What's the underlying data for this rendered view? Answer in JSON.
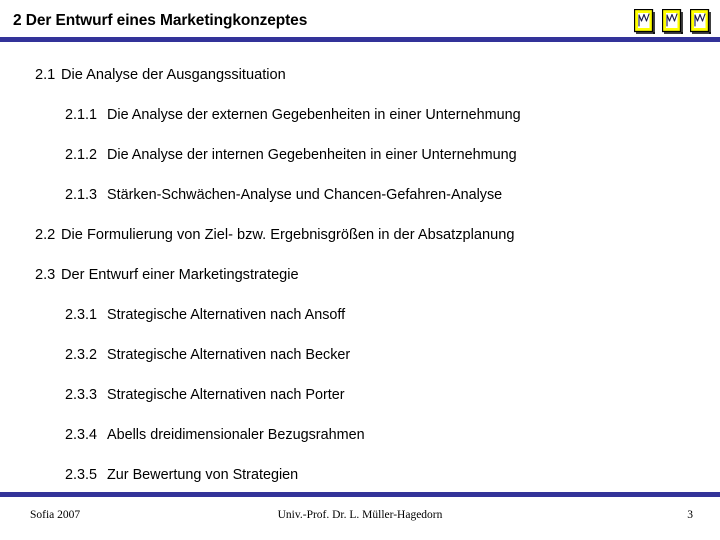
{
  "slide": {
    "header": {
      "title": "2 Der Entwurf eines Marketingkonzeptes",
      "icons": [
        {
          "name": "note-page-icon-1",
          "label": "note-page-icon"
        },
        {
          "name": "note-page-icon-2",
          "label": "note-page-icon"
        },
        {
          "name": "note-page-icon-3",
          "label": "note-page-icon"
        }
      ]
    },
    "colors": {
      "accent_rule": "#333399",
      "icon_fill": "#ffff00",
      "icon_inner": "#ffffff",
      "icon_border": "#000000",
      "text": "#000000",
      "background": "#ffffff"
    },
    "outline": [
      {
        "level": 1,
        "number": "2.1",
        "text": "Die Analyse der Ausgangssituation"
      },
      {
        "level": 2,
        "number": "2.1.1",
        "text": "Die Analyse der externen Gegebenheiten in einer Unternehmung"
      },
      {
        "level": 2,
        "number": "2.1.2",
        "text": "Die Analyse der internen Gegebenheiten in einer Unternehmung"
      },
      {
        "level": 2,
        "number": "2.1.3",
        "text": "Stärken-Schwächen-Analyse und Chancen-Gefahren-Analyse"
      },
      {
        "level": 1,
        "number": "2.2",
        "text": "Die Formulierung von Ziel- bzw. Ergebnisgrößen in der Absatzplanung"
      },
      {
        "level": 1,
        "number": "2.3",
        "text": "Der Entwurf einer Marketingstrategie"
      },
      {
        "level": 2,
        "number": "2.3.1",
        "text": "Strategische Alternativen nach Ansoff"
      },
      {
        "level": 2,
        "number": "2.3.2",
        "text": "Strategische Alternativen nach Becker"
      },
      {
        "level": 2,
        "number": "2.3.3",
        "text": "Strategische Alternativen nach Porter"
      },
      {
        "level": 2,
        "number": "2.3.4",
        "text": "Abells dreidimensionaler Bezugsrahmen"
      },
      {
        "level": 2,
        "number": "2.3.5",
        "text": "Zur Bewertung von Strategien"
      }
    ],
    "footer": {
      "left": "Sofia 2007",
      "center": "Univ.-Prof. Dr. L. Müller-Hagedorn",
      "right": "3"
    }
  }
}
